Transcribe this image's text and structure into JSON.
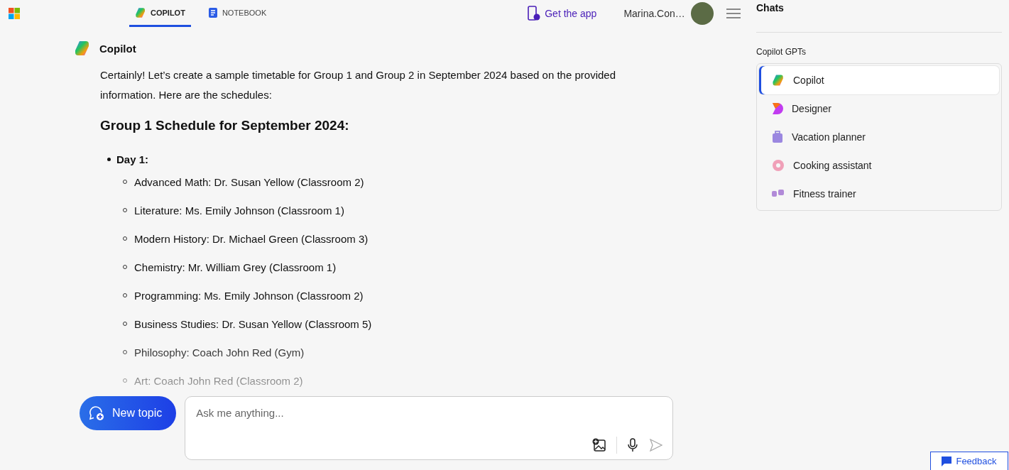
{
  "tabs": [
    {
      "label": "COPILOT",
      "kind": "copilot",
      "selected": true
    },
    {
      "label": "NOTEBOOK",
      "kind": "notebook",
      "selected": false
    }
  ],
  "get_app": "Get the app",
  "user": "Marina.Con…",
  "message": {
    "author": "Copilot",
    "intro": "Certainly! Let’s create a sample timetable for Group 1 and Group 2 in September 2024 based on the provided information. Here are the schedules:",
    "heading": "Group 1 Schedule for September 2024:",
    "days": [
      {
        "label": "Day 1:",
        "items": [
          "Advanced Math: Dr. Susan Yellow (Classroom 2)",
          "Literature: Ms. Emily Johnson (Classroom 1)",
          "Modern History: Dr. Michael Green (Classroom 3)",
          "Chemistry: Mr. William Grey (Classroom 1)",
          "Programming: Ms. Emily Johnson (Classroom 2)",
          "Business Studies: Dr. Susan Yellow (Classroom 5)",
          "Philosophy: Coach John Red (Gym)",
          "Art: Coach John Red (Classroom 2)"
        ]
      }
    ]
  },
  "new_topic": "New topic",
  "composer": {
    "placeholder": "Ask me anything..."
  },
  "sidebar": {
    "title": "Chats",
    "section": "Copilot GPTs",
    "items": [
      {
        "label": "Copilot",
        "kind": "copilot",
        "selected": true
      },
      {
        "label": "Designer",
        "kind": "designer",
        "selected": false
      },
      {
        "label": "Vacation planner",
        "kind": "travel",
        "selected": false
      },
      {
        "label": "Cooking assistant",
        "kind": "cooking",
        "selected": false
      },
      {
        "label": "Fitness trainer",
        "kind": "fitness",
        "selected": false
      }
    ]
  },
  "feedback": "Feedback"
}
